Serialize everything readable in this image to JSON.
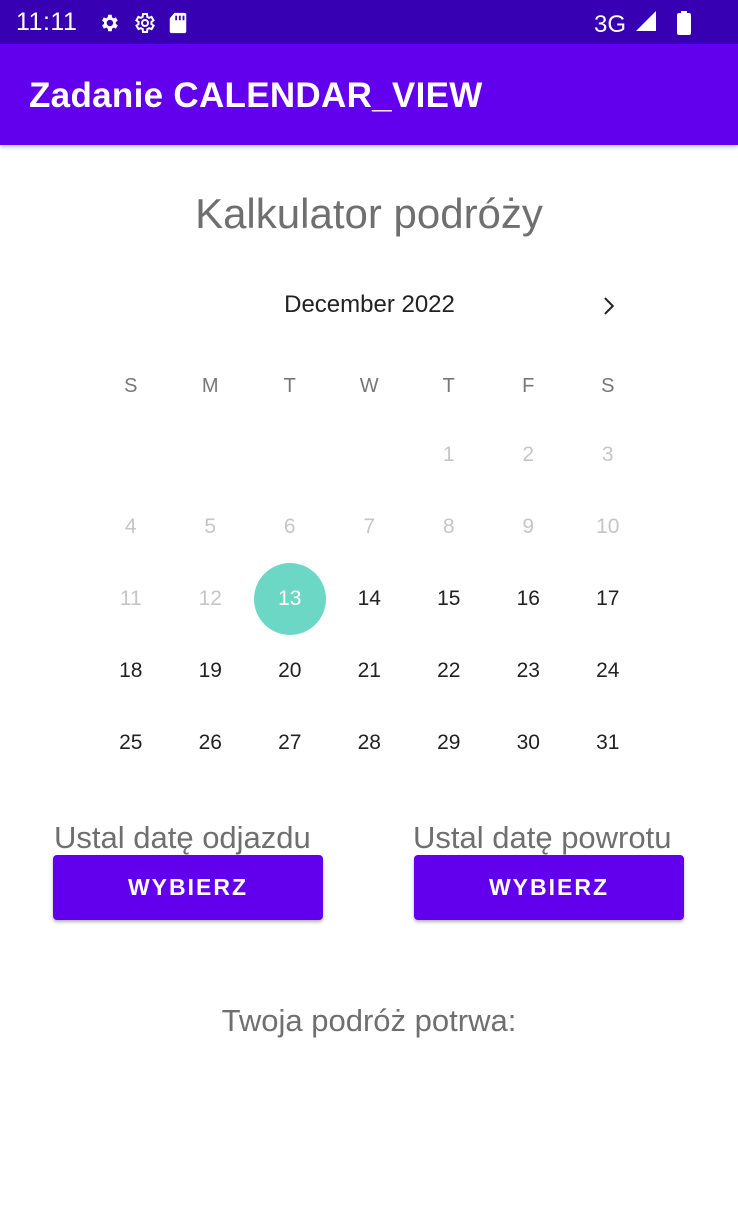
{
  "status_bar": {
    "time": "11:11",
    "network": "3G",
    "icons": [
      "settings-icon",
      "settings-outline-icon",
      "sd-card-icon",
      "signal-icon",
      "battery-icon"
    ]
  },
  "app_bar": {
    "title": "Zadanie CALENDAR_VIEW"
  },
  "page_title": "Kalkulator podróży",
  "calendar": {
    "month_label": "December 2022",
    "weekdays": [
      "S",
      "M",
      "T",
      "W",
      "T",
      "F",
      "S"
    ],
    "weeks": [
      [
        {
          "label": "",
          "state": "empty"
        },
        {
          "label": "",
          "state": "empty"
        },
        {
          "label": "",
          "state": "empty"
        },
        {
          "label": "",
          "state": "empty"
        },
        {
          "label": "1",
          "state": "disabled"
        },
        {
          "label": "2",
          "state": "disabled"
        },
        {
          "label": "3",
          "state": "disabled"
        }
      ],
      [
        {
          "label": "4",
          "state": "disabled"
        },
        {
          "label": "5",
          "state": "disabled"
        },
        {
          "label": "6",
          "state": "disabled"
        },
        {
          "label": "7",
          "state": "disabled"
        },
        {
          "label": "8",
          "state": "disabled"
        },
        {
          "label": "9",
          "state": "disabled"
        },
        {
          "label": "10",
          "state": "disabled"
        }
      ],
      [
        {
          "label": "11",
          "state": "disabled"
        },
        {
          "label": "12",
          "state": "disabled"
        },
        {
          "label": "13",
          "state": "selected"
        },
        {
          "label": "14",
          "state": "enabled"
        },
        {
          "label": "15",
          "state": "enabled"
        },
        {
          "label": "16",
          "state": "enabled"
        },
        {
          "label": "17",
          "state": "enabled"
        }
      ],
      [
        {
          "label": "18",
          "state": "enabled"
        },
        {
          "label": "19",
          "state": "enabled"
        },
        {
          "label": "20",
          "state": "enabled"
        },
        {
          "label": "21",
          "state": "enabled"
        },
        {
          "label": "22",
          "state": "enabled"
        },
        {
          "label": "23",
          "state": "enabled"
        },
        {
          "label": "24",
          "state": "enabled"
        }
      ],
      [
        {
          "label": "25",
          "state": "enabled"
        },
        {
          "label": "26",
          "state": "enabled"
        },
        {
          "label": "27",
          "state": "enabled"
        },
        {
          "label": "28",
          "state": "enabled"
        },
        {
          "label": "29",
          "state": "enabled"
        },
        {
          "label": "30",
          "state": "enabled"
        },
        {
          "label": "31",
          "state": "enabled"
        }
      ]
    ],
    "selected_color": "#6dd7c6"
  },
  "departure": {
    "label": "Ustal datę odjazdu",
    "button": "WYBIERZ"
  },
  "return": {
    "label": "Ustal datę powrotu",
    "button": "WYBIERZ"
  },
  "result_text": "Twoja podróż potrwa:",
  "colors": {
    "status_bar": "#3700B3",
    "primary": "#6200EE",
    "selected_day": "#6dd7c6"
  }
}
